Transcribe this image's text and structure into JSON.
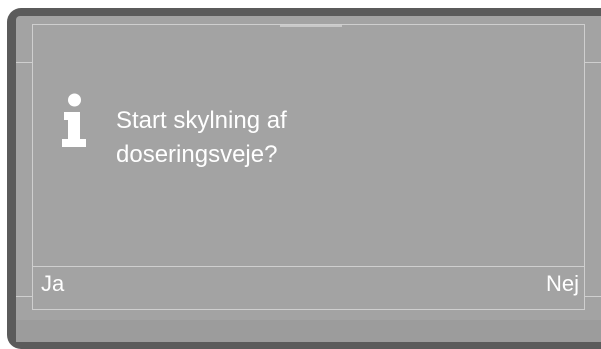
{
  "dialog": {
    "icon": "info-icon",
    "message_line1": "Start skylning af",
    "message_line2": "doseringsveje?"
  },
  "softkeys": {
    "left_label": "Ja",
    "right_label": "Nej"
  },
  "colors": {
    "bezel": "#5b5b5b",
    "screen": "#a3a3a3",
    "text": "#ffffff",
    "frame_lines": "#cfcfcf"
  }
}
